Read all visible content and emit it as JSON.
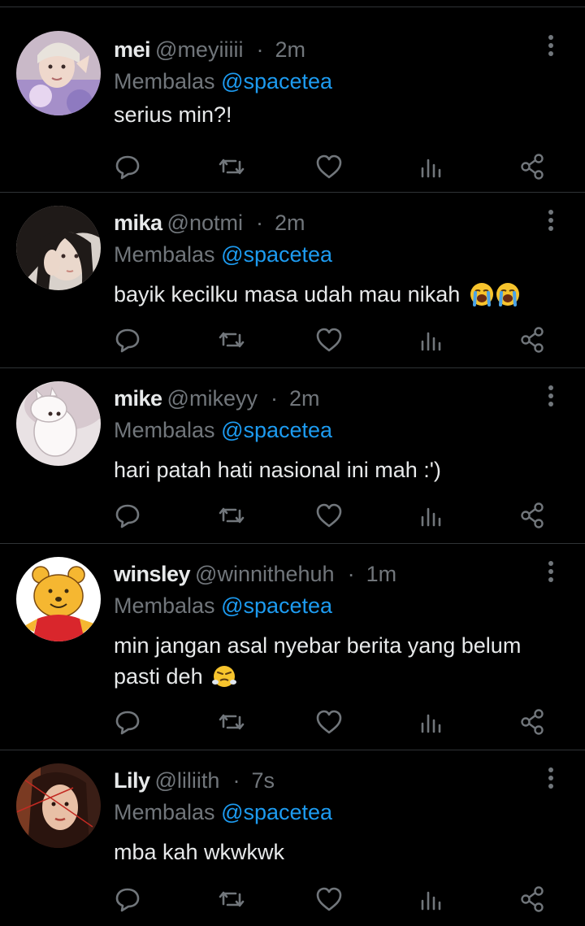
{
  "replying_prefix": "Membalas",
  "colors": {
    "background": "#000000",
    "text": "#e7e9ea",
    "secondary": "#71767b",
    "accent": "#1d9bf0",
    "divider": "#2f3336"
  },
  "action_icons": [
    "reply-icon",
    "retweet-icon",
    "like-icon",
    "views-icon",
    "share-icon"
  ],
  "replies": [
    {
      "name": "mei",
      "handle": "@meyiiiii",
      "dot": "·",
      "time": "2m",
      "mention": "@spacetea",
      "text": "serius min?!",
      "emoji": []
    },
    {
      "name": "mika",
      "handle": "@notmi",
      "dot": "·",
      "time": "2m",
      "mention": "@spacetea",
      "text": "bayik kecilku masa udah mau nikah",
      "emoji": [
        "loudly-crying-face",
        "loudly-crying-face"
      ]
    },
    {
      "name": "mike",
      "handle": "@mikeyy",
      "dot": "·",
      "time": "2m",
      "mention": "@spacetea",
      "text": "hari patah hati nasional ini mah :')",
      "emoji": []
    },
    {
      "name": "winsley",
      "handle": "@winnithehuh",
      "dot": "·",
      "time": "1m",
      "mention": "@spacetea",
      "text": "min jangan asal nyebar berita yang belum pasti deh",
      "emoji": [
        "face-with-steam"
      ]
    },
    {
      "name": "Lily",
      "handle": "@liliith",
      "dot": "·",
      "time": "7s",
      "mention": "@spacetea",
      "text": "mba kah wkwkwk",
      "emoji": []
    }
  ]
}
